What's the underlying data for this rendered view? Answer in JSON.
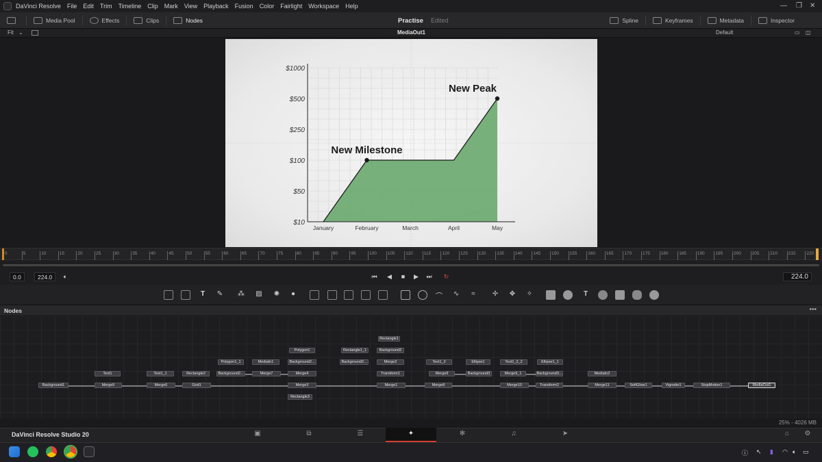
{
  "menubar": {
    "items": [
      "DaVinci Resolve",
      "File",
      "Edit",
      "Trim",
      "Timeline",
      "Clip",
      "Mark",
      "View",
      "Playback",
      "Fusion",
      "Color",
      "Fairlight",
      "Workspace",
      "Help"
    ]
  },
  "toolbar": {
    "media_pool": "Media Pool",
    "effects": "Effects",
    "clips": "Clips",
    "nodes": "Nodes",
    "project_title": "Practise",
    "project_status": "Edited",
    "spline": "Spline",
    "keyframes": "Keyframes",
    "metadata": "Metadata",
    "inspector": "Inspector"
  },
  "viewer": {
    "fit": "Fit",
    "output_name": "MediaOut1",
    "layout_preset": "Default"
  },
  "chart_data": {
    "type": "area",
    "categories": [
      "January",
      "February",
      "March",
      "April",
      "May"
    ],
    "y_ticks": [
      "$10",
      "$50",
      "$100",
      "$250",
      "$500",
      "$1000"
    ],
    "points": [
      {
        "x": "January",
        "y": 10
      },
      {
        "x": "February",
        "y": 100
      },
      {
        "x": "March",
        "y": 100
      },
      {
        "x": "April",
        "y": 100
      },
      {
        "x": "May",
        "y": 500
      }
    ],
    "annotations": [
      {
        "label": "New Milestone",
        "x": "February",
        "y": 100
      },
      {
        "label": "New Peak",
        "x": "May",
        "y": 500
      }
    ],
    "fill_color": "#6aa86e",
    "grid": true
  },
  "ruler": {
    "ticks": [
      "0",
      "5",
      "10",
      "15",
      "20",
      "25",
      "30",
      "35",
      "40",
      "45",
      "50",
      "55",
      "60",
      "65",
      "70",
      "75",
      "80",
      "85",
      "90",
      "95",
      "100",
      "105",
      "110",
      "115",
      "120",
      "125",
      "130",
      "135",
      "140",
      "145",
      "150",
      "155",
      "160",
      "165",
      "170",
      "175",
      "180",
      "185",
      "190",
      "195",
      "200",
      "205",
      "210",
      "215",
      "220"
    ]
  },
  "transport": {
    "start": "0.0",
    "end": "224.0",
    "current": "224.0"
  },
  "nodes_panel": {
    "title": "Nodes",
    "status": "25% - 4026 MB",
    "nodes": [
      {
        "id": "Background1"
      },
      {
        "id": "Text1"
      },
      {
        "id": "Merge5"
      },
      {
        "id": "Text1_1"
      },
      {
        "id": "Merge6"
      },
      {
        "id": "Rectangle2"
      },
      {
        "id": "Grid1"
      },
      {
        "id": "Polygon1_1"
      },
      {
        "id": "Background2..."
      },
      {
        "id": "MediaIn1"
      },
      {
        "id": "Merge7"
      },
      {
        "id": "Polygon1"
      },
      {
        "id": "Background2..."
      },
      {
        "id": "Merge4"
      },
      {
        "id": "Merge3"
      },
      {
        "id": "Rectangle3"
      },
      {
        "id": "Rectangle1_1"
      },
      {
        "id": "Background2..."
      },
      {
        "id": "Rectangle1"
      },
      {
        "id": "Background2"
      },
      {
        "id": "Merge2"
      },
      {
        "id": "Transform1"
      },
      {
        "id": "Merge1"
      },
      {
        "id": "Text1_2"
      },
      {
        "id": "Merge9"
      },
      {
        "id": "Merge8"
      },
      {
        "id": "Ellipse1"
      },
      {
        "id": "Background3"
      },
      {
        "id": "Text1_2_2"
      },
      {
        "id": "Merge9_1"
      },
      {
        "id": "Merge10"
      },
      {
        "id": "Ellipse1_1"
      },
      {
        "id": "Background3..."
      },
      {
        "id": "Transform2"
      },
      {
        "id": "MediaIn2"
      },
      {
        "id": "Merge11"
      },
      {
        "id": "SoftGlow1"
      },
      {
        "id": "Vignette1"
      },
      {
        "id": "StopMotion1"
      },
      {
        "id": "MediaOut1"
      }
    ]
  },
  "pagebar": {
    "brand": "DaVinci Resolve Studio 20"
  }
}
